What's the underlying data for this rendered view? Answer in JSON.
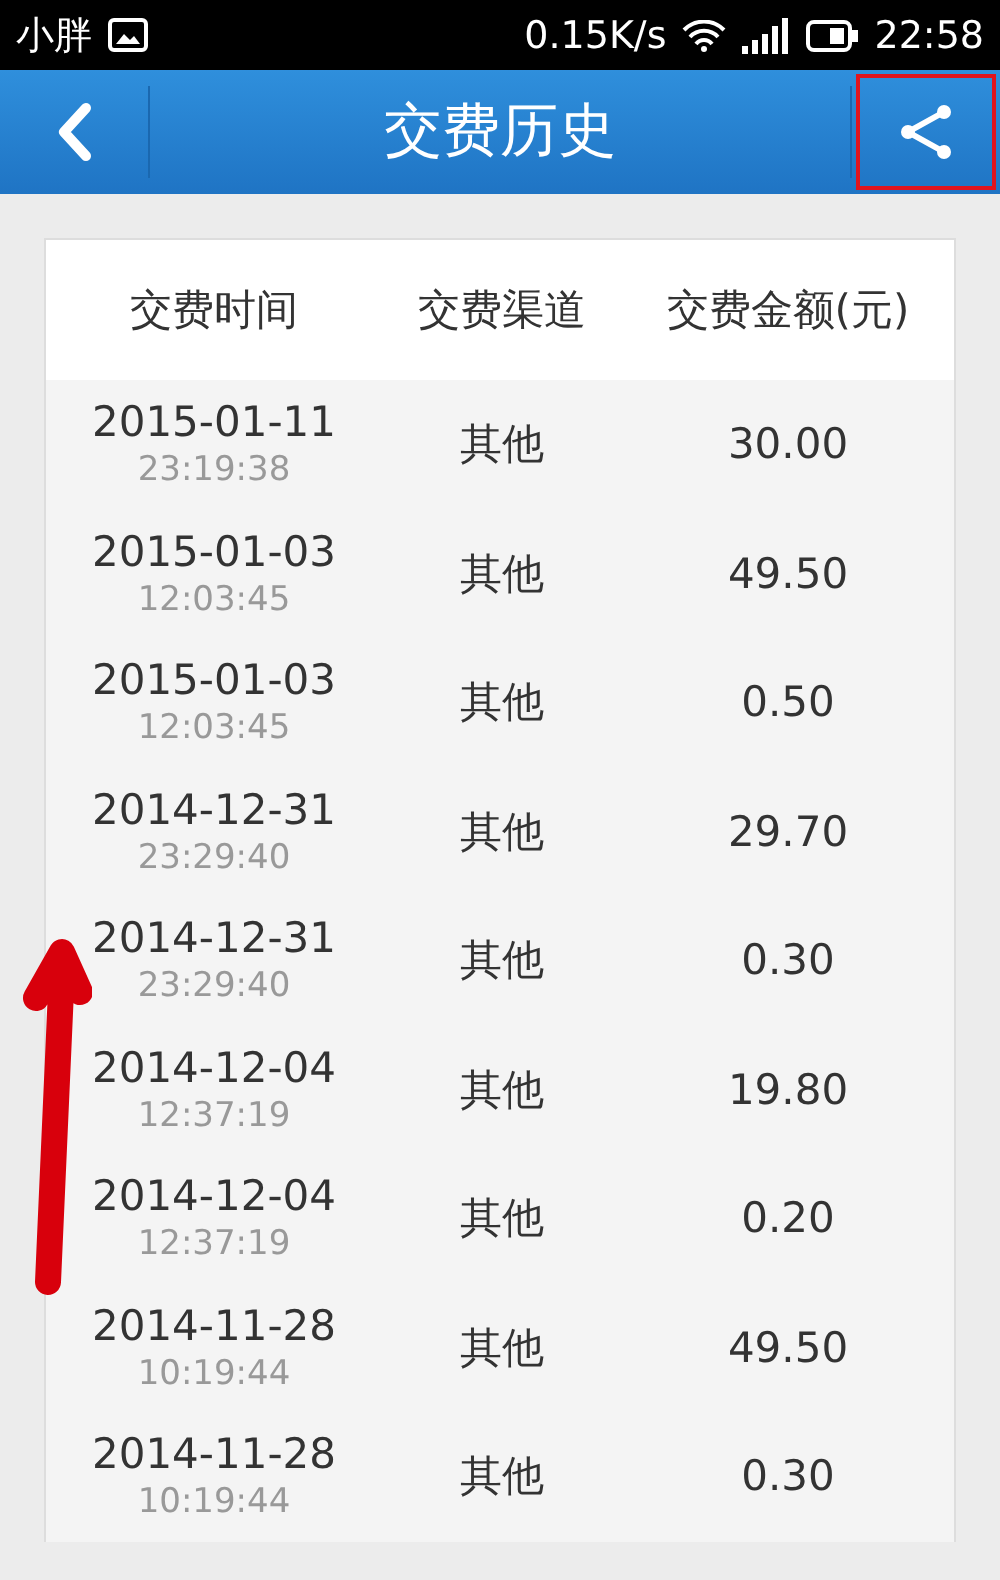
{
  "status_bar": {
    "app": "小胖",
    "speed": "0.15K/s",
    "time": "22:58"
  },
  "header": {
    "title": "交费历史",
    "share_highlighted": true
  },
  "table": {
    "columns": [
      "交费时间",
      "交费渠道",
      "交费金额(元)"
    ],
    "rows": [
      {
        "date": "2015-01-11",
        "time": "23:19:38",
        "channel": "其他",
        "amount": "30.00"
      },
      {
        "date": "2015-01-03",
        "time": "12:03:45",
        "channel": "其他",
        "amount": "49.50"
      },
      {
        "date": "2015-01-03",
        "time": "12:03:45",
        "channel": "其他",
        "amount": "0.50"
      },
      {
        "date": "2014-12-31",
        "time": "23:29:40",
        "channel": "其他",
        "amount": "29.70"
      },
      {
        "date": "2014-12-31",
        "time": "23:29:40",
        "channel": "其他",
        "amount": "0.30"
      },
      {
        "date": "2014-12-04",
        "time": "12:37:19",
        "channel": "其他",
        "amount": "19.80"
      },
      {
        "date": "2014-12-04",
        "time": "12:37:19",
        "channel": "其他",
        "amount": "0.20"
      },
      {
        "date": "2014-11-28",
        "time": "10:19:44",
        "channel": "其他",
        "amount": "49.50"
      },
      {
        "date": "2014-11-28",
        "time": "10:19:44",
        "channel": "其他",
        "amount": "0.30"
      }
    ]
  },
  "annotation": {
    "kind": "arrow"
  }
}
